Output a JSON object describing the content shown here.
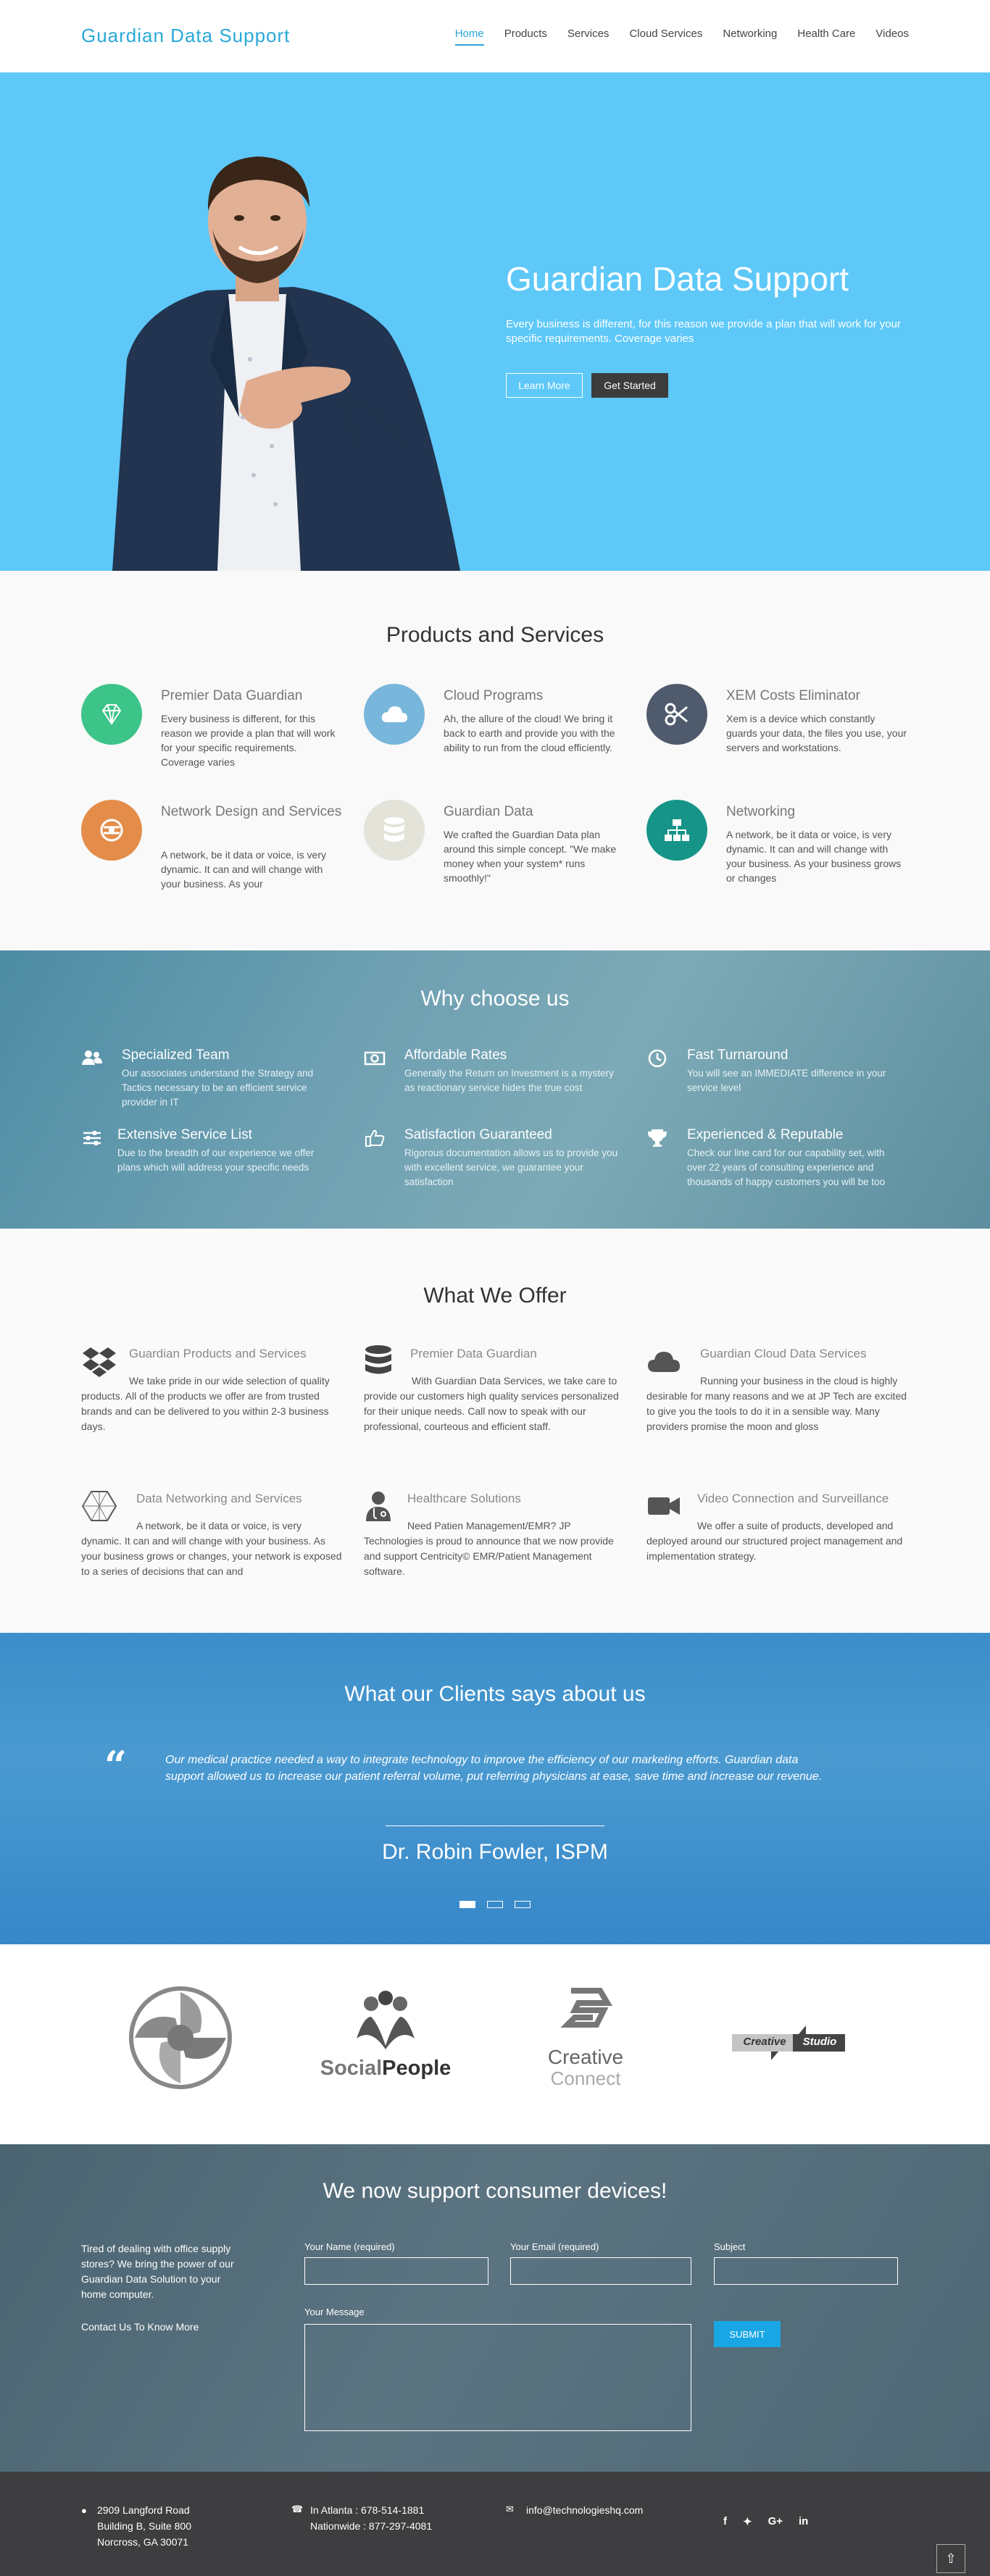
{
  "header": {
    "logo": "Guardian Data Support",
    "nav": [
      "Home",
      "Products",
      "Services",
      "Cloud Services",
      "Networking",
      "Health Care",
      "Videos"
    ]
  },
  "hero": {
    "title": "Guardian Data Support",
    "text": "Every business is different, for this reason we provide a plan that will work for your specific requirements. Coverage varies",
    "learn_more": "Learn More",
    "get_started": "Get Started"
  },
  "products": {
    "title": "Products and Services",
    "items": [
      {
        "title": "Premier Data Guardian",
        "text": "Every business is different, for this reason we provide a plan that will work for your specific requirements. Coverage varies",
        "color": "#3cc489",
        "icon": "diamond-icon"
      },
      {
        "title": "Cloud Programs",
        "text": "Ah, the allure of the cloud! We bring it back to earth and provide you with the ability to run from the cloud efficiently.",
        "color": "#78b6dc",
        "icon": "cloud-icon"
      },
      {
        "title": "XEM Costs Eliminator",
        "text": "Xem is a device which constantly guards your data, the files you use, your servers and workstations.",
        "color": "#4f5a6c",
        "icon": "scissors-icon"
      },
      {
        "title": "Network Design and Services",
        "text": "A network, be it data or voice, is very dynamic. It can and will change with your business. As your",
        "color": "#e48d4a",
        "icon": "network-design-icon"
      },
      {
        "title": "Guardian Data",
        "text": "We crafted the Guardian Data plan around this simple concept. \"We make money when your system* runs smoothly!\"",
        "color": "#e3e3d9",
        "icon": "database-icon"
      },
      {
        "title": "Networking",
        "text": "A network, be it data or voice, is very dynamic. It can and will change with your business. As your business grows or changes",
        "color": "#169488",
        "icon": "sitemap-icon"
      }
    ]
  },
  "why": {
    "title": "Why choose us",
    "items": [
      {
        "title": "Specialized Team",
        "text": "Our associates understand the Strategy and Tactics necessary to be an efficient service provider in IT",
        "icon": "users-icon"
      },
      {
        "title": "Affordable Rates",
        "text": "Generally the Return on Investment is a mystery as reactionary service hides the true cost",
        "icon": "money-icon"
      },
      {
        "title": "Fast Turnaround",
        "text": "You will see an IMMEDIATE difference in your service level",
        "icon": "clock-icon"
      },
      {
        "title": "Extensive Service List",
        "text": "Due to the breadth of our experience we offer plans which will address your specific needs",
        "icon": "sliders-icon"
      },
      {
        "title": "Satisfaction Guaranteed",
        "text": "Rigorous documentation allows us to provide you with excellent service, we guarantee your satisfaction",
        "icon": "thumbs-up-icon"
      },
      {
        "title": "Experienced & Reputable",
        "text": "Check our line card for our capability set, with over 22 years of consulting experience and thousands of happy customers you will be too",
        "icon": "trophy-icon"
      }
    ]
  },
  "offer": {
    "title": "What We Offer",
    "items": [
      {
        "title": "Guardian Products and Services",
        "text": "We take pride in our wide selection of quality products. All of the products we offer are from trusted brands and can be delivered to you within 2-3 business days.",
        "icon": "dropbox-icon"
      },
      {
        "title": "Premier Data Guardian",
        "text": "With Guardian Data Services, we take care to provide our customers high quality services personalized for their unique needs. Call now to speak with our professional, courteous and efficient staff.",
        "icon": "database-icon"
      },
      {
        "title": "Guardian Cloud Data Services",
        "text": "Running your business in the cloud is highly desirable for many reasons and we at JP Tech are excited to give you the tools to do it in a sensible way. Many providers promise the moon and gloss",
        "icon": "cloud-icon"
      },
      {
        "title": "Data Networking and Services",
        "text": "A network, be it data or voice, is very dynamic. It can and will change with your business. As your business grows or changes, your network is exposed to a series of decisions that can and",
        "icon": "hexagon-network-icon"
      },
      {
        "title": "Healthcare Solutions",
        "text": "Need Patien Management/EMR? JP Technologies is proud to announce that we now provide and support Centricity© EMR/Patient Management software.",
        "icon": "doctor-icon"
      },
      {
        "title": "Video Connection and Surveillance",
        "text": "We offer a suite of products, developed and deployed around our structured project management and implementation strategy.",
        "icon": "video-camera-icon"
      }
    ]
  },
  "testimonial": {
    "title": "What our Clients says about us",
    "quote": "Our medical practice needed a way to integrate technology to improve the efficiency of our marketing efforts. Guardian data support allowed us to increase our patient referral volume, put referring physicians at ease, save time and increase our revenue.",
    "author": "Dr. Robin Fowler, ISPM",
    "slides": 3,
    "active_slide": 1
  },
  "partners": {
    "logos": [
      {
        "icon": "circular-gears-logo"
      },
      {
        "name_a": "Social",
        "name_b": "People",
        "icon": "social-people-logo"
      },
      {
        "name_a": "Creative",
        "name_b": "Connect",
        "icon": "creative-connect-logo"
      },
      {
        "name_a": "Creative",
        "name_b": "Studio",
        "icon": "creative-studio-logo"
      }
    ]
  },
  "contact": {
    "title": "We now support consumer devices!",
    "intro": "Tired of dealing with office supply stores? We bring the power of our Guardian Data Solution to your home computer.",
    "more": "Contact Us To Know More",
    "name_label": "Your Name (required)",
    "email_label": "Your Email (required)",
    "subject_label": "Subject",
    "message_label": "Your Message",
    "submit": "SUBMIT"
  },
  "footer": {
    "address_1": "2909 Langford Road",
    "address_2": "Building B, Suite 800",
    "address_3": "Norcross, GA 30071",
    "phone_1": "In Atlanta : 678-514-1881",
    "phone_2": "Nationwide : 877-297-4081",
    "email": "info@technologieshq.com",
    "social": [
      "f",
      "t",
      "G+",
      "in"
    ]
  }
}
